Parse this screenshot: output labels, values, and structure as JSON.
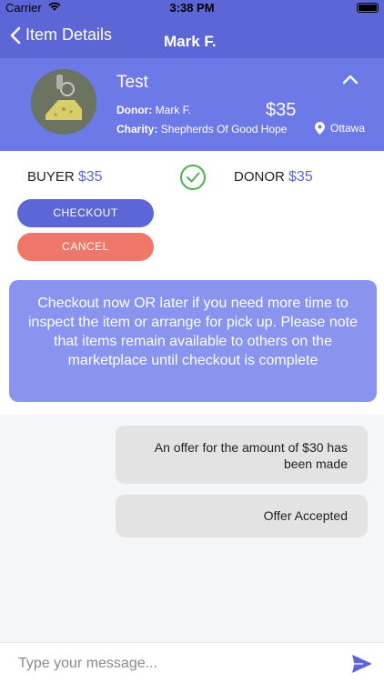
{
  "status": {
    "carrier": "Carrier",
    "time": "3:38 PM"
  },
  "nav": {
    "back_label": "Item Details",
    "title": "Mark F."
  },
  "item": {
    "title": "Test",
    "donor_label": "Donor:",
    "donor_name": "Mark F.",
    "price": "$35",
    "charity_label": "Charity:",
    "charity_name": "Shepherds Of Good Hope",
    "location": "Ottawa"
  },
  "offer": {
    "buyer_label": "BUYER",
    "buyer_amount": "$35",
    "donor_label": "DONOR",
    "donor_amount": "$35",
    "checkout_label": "CHECKOUT",
    "cancel_label": "CANCEL",
    "notice": "Checkout now OR later if you need more time to inspect the item or arrange for pick up. Please note that items remain available to others on the marketplace until checkout is complete"
  },
  "messages": [
    {
      "text": "An offer for the amount of $30 has been made"
    },
    {
      "text": "Offer Accepted"
    }
  ],
  "composer": {
    "placeholder": "Type your message..."
  },
  "icons": {
    "back": "chevron-left-icon",
    "collapse": "chevron-up-icon",
    "location": "location-pin-icon",
    "accepted": "check-circle-icon",
    "send": "send-icon"
  },
  "colors": {
    "primary": "#5c66d6",
    "card": "#6e79e8",
    "notice": "#8994ee",
    "cancel": "#ee7769",
    "accepted": "#4caf50"
  }
}
